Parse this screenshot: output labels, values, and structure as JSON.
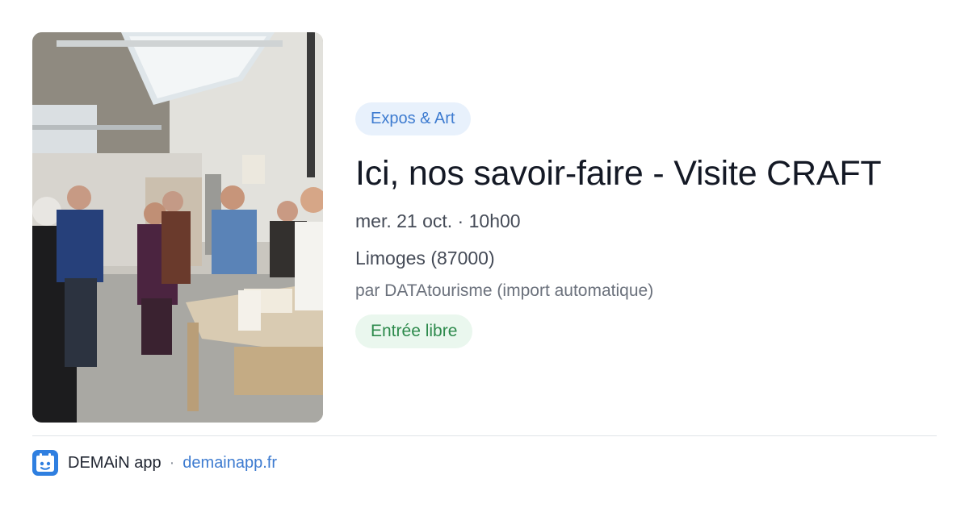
{
  "card": {
    "image_alt": "Workshop visit in a craft studio",
    "category": "Expos & Art",
    "title": "Ici, nos savoir-faire - Visite CRAFT",
    "date": "mer. 21 oct. · 10h00",
    "location": "Limoges (87000)",
    "source": "par DATAtourisme (import automatique)",
    "price": "Entrée libre"
  },
  "footer": {
    "app_name": "DEMAiN app",
    "separator": "·",
    "link": "demainapp.fr",
    "app_icon": "demain-app-icon"
  },
  "colors": {
    "category_bg": "#e8f1fc",
    "category_text": "#3d7bd0",
    "price_bg": "#eaf7ee",
    "price_text": "#2d8a4c",
    "link": "#3d7bd0",
    "app_icon_bg": "#2f7fe0"
  }
}
